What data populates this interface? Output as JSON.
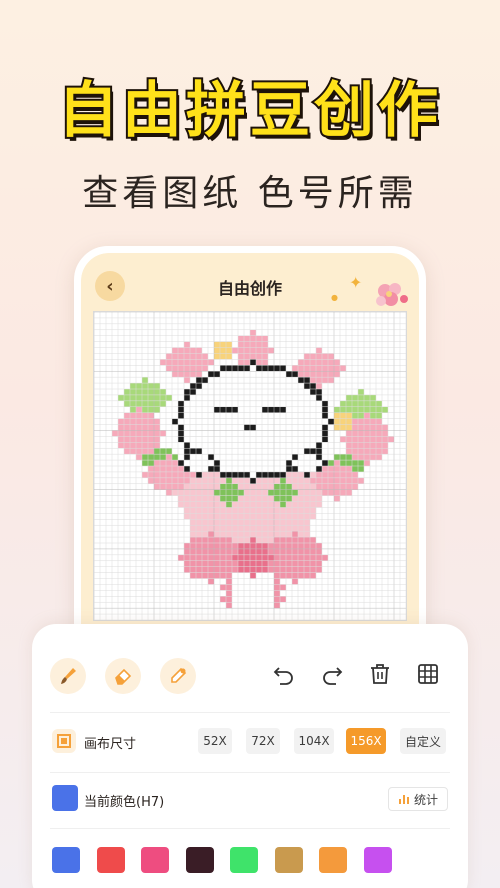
{
  "headline": "自由拼豆创作",
  "subheadline": "查看图纸 色号所需",
  "screen": {
    "title": "自由创作",
    "back_icon": "chevron-left-icon"
  },
  "tools": {
    "left": [
      "brush-icon",
      "eraser-icon",
      "eyedropper-icon"
    ],
    "right": [
      "undo-icon",
      "redo-icon",
      "trash-icon",
      "grid-icon"
    ]
  },
  "canvas_size": {
    "label": "画布尺寸",
    "options": [
      "52X",
      "72X",
      "104X",
      "156X",
      "自定义"
    ],
    "selected": "156X"
  },
  "current_color": {
    "label": "当前颜色(H7)",
    "color": "#4a72e8",
    "stats_label": "统计"
  },
  "palette": [
    "#4a72e8",
    "#ef4b4b",
    "#ee4d80",
    "#3a1d26",
    "#3fe36a",
    "#c99a4e",
    "#f49a3c",
    "#c650ef"
  ]
}
